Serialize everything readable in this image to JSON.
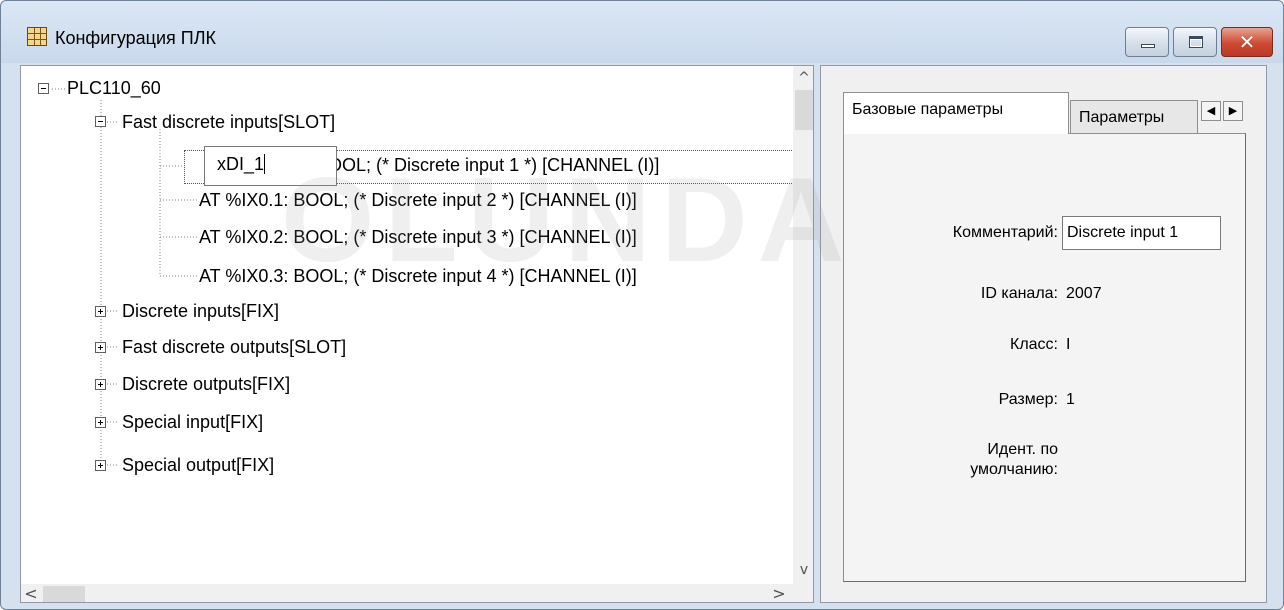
{
  "window": {
    "title": "Конфигурация ПЛК"
  },
  "tree": {
    "root": "PLC110_60",
    "group_fast_inputs": "Fast discrete inputs[SLOT]",
    "edit_value": "xDI_1",
    "channels": [
      "BOOL; (* Discrete input 1 *) [CHANNEL (I)]",
      "AT %IX0.1: BOOL; (* Discrete input 2 *) [CHANNEL (I)]",
      "AT %IX0.2: BOOL; (* Discrete input 3 *) [CHANNEL (I)]",
      "AT %IX0.3: BOOL; (* Discrete input 4 *) [CHANNEL (I)]"
    ],
    "groups": [
      "Discrete inputs[FIX]",
      "Fast discrete outputs[SLOT]",
      "Discrete outputs[FIX]",
      "Special input[FIX]",
      "Special output[FIX]"
    ]
  },
  "watermark": "OLUNDA",
  "properties": {
    "tabs": [
      "Базовые параметры",
      "Параметры"
    ],
    "comment_label": "Комментарий:",
    "comment_value": "Discrete input 1",
    "channel_id_label": "ID канала:",
    "channel_id_value": "2007",
    "class_label": "Класс:",
    "class_value": "I",
    "size_label": "Размер:",
    "size_value": "1",
    "default_ident_label_1": "Идент. по",
    "default_ident_label_2": "умолчанию:"
  }
}
